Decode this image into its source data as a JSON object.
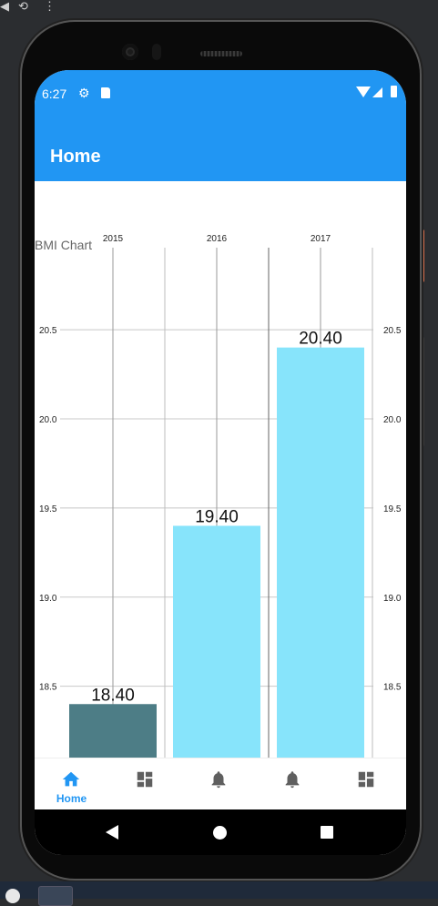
{
  "device": {
    "status_time": "6:27",
    "icons": [
      "gear-icon",
      "sd-card-icon",
      "wifi-icon",
      "signal-icon",
      "battery-icon"
    ]
  },
  "app": {
    "title": "Home",
    "accent_color": "#2196f3"
  },
  "chart_data": {
    "type": "bar",
    "title": "BMI Chart",
    "categories": [
      "2015",
      "2016",
      "2017"
    ],
    "values": [
      18.4,
      19.4,
      20.4
    ],
    "value_labels": [
      "18.40",
      "19.40",
      "20.40"
    ],
    "bar_colors": [
      "#4d7d86",
      "#87e4fb",
      "#87e4fb"
    ],
    "y_ticks": [
      "18.5",
      "19.0",
      "19.5",
      "20.0",
      "20.5"
    ],
    "y_tick_values": [
      18.5,
      19.0,
      19.5,
      20.0,
      20.5
    ],
    "ylim": [
      18.1,
      20.96
    ],
    "grid": true,
    "axes_mirrored": "left-right"
  },
  "bottom_nav": {
    "items": [
      {
        "label": "Home",
        "icon": "home-icon",
        "selected": true
      },
      {
        "label": "",
        "icon": "dashboard-icon",
        "selected": false
      },
      {
        "label": "",
        "icon": "bell-icon",
        "selected": false
      },
      {
        "label": "",
        "icon": "bell-icon",
        "selected": false
      },
      {
        "label": "",
        "icon": "dashboard-icon",
        "selected": false
      }
    ]
  }
}
